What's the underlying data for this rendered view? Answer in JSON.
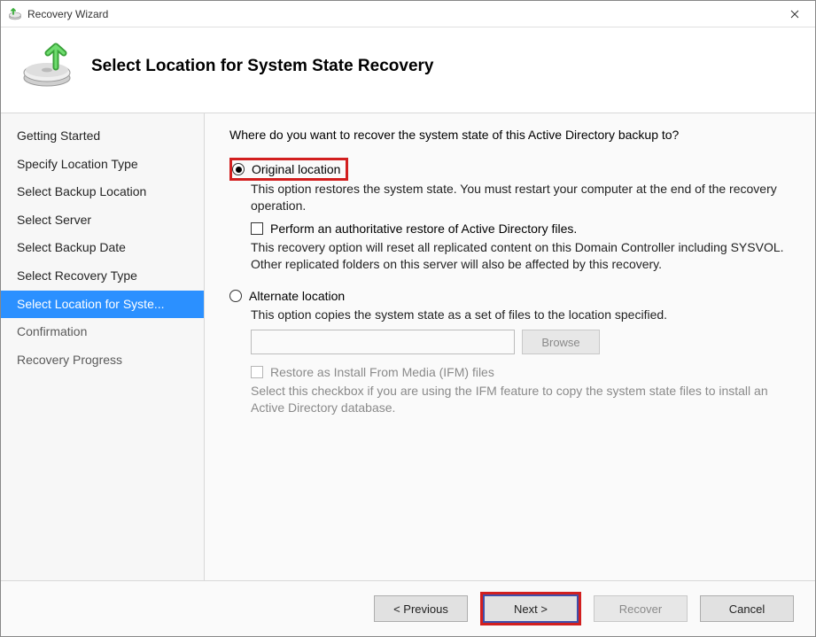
{
  "window": {
    "title": "Recovery Wizard"
  },
  "header": {
    "title": "Select Location for System State Recovery"
  },
  "sidebar": {
    "items": [
      {
        "label": "Getting Started",
        "state": "past"
      },
      {
        "label": "Specify Location Type",
        "state": "past"
      },
      {
        "label": "Select Backup Location",
        "state": "past"
      },
      {
        "label": "Select Server",
        "state": "past"
      },
      {
        "label": "Select Backup Date",
        "state": "past"
      },
      {
        "label": "Select Recovery Type",
        "state": "past"
      },
      {
        "label": "Select Location for Syste...",
        "state": "current"
      },
      {
        "label": "Confirmation",
        "state": "future"
      },
      {
        "label": "Recovery Progress",
        "state": "future"
      }
    ]
  },
  "panel": {
    "question": "Where do you want to recover the system state of this Active Directory backup to?",
    "original": {
      "label": "Original location",
      "desc": "This option restores the system state. You must restart your computer at the end of the recovery operation.",
      "auth_checkbox_label": "Perform an authoritative restore of Active Directory files.",
      "auth_desc": "This recovery option will reset all replicated content on this Domain Controller including SYSVOL. Other replicated folders on this server will also be affected by this recovery."
    },
    "alternate": {
      "label": "Alternate location",
      "desc": "This option copies the system state as a set of files to the location specified.",
      "path_value": "",
      "browse_label": "Browse",
      "ifm_checkbox_label": "Restore as Install From Media (IFM) files",
      "ifm_desc": "Select this checkbox if you are using the IFM feature to copy the system state files to install an Active Directory database."
    }
  },
  "footer": {
    "previous": "<  Previous",
    "next": "Next  >",
    "recover": "Recover",
    "cancel": "Cancel"
  }
}
